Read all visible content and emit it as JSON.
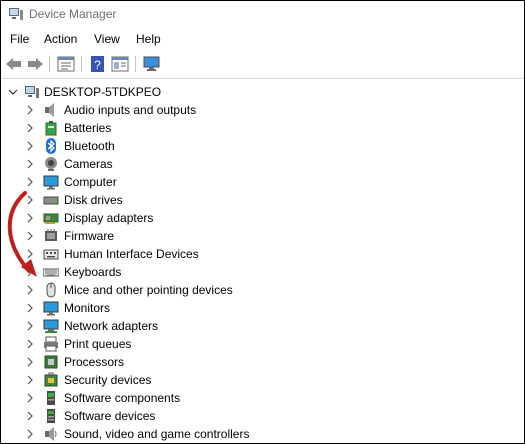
{
  "window": {
    "title": "Device Manager"
  },
  "menu": {
    "file": "File",
    "action": "Action",
    "view": "View",
    "help": "Help"
  },
  "tree": {
    "root": "DESKTOP-5TDKPEO",
    "items": [
      {
        "label": "Audio inputs and outputs",
        "icon": "speaker-icon"
      },
      {
        "label": "Batteries",
        "icon": "battery-icon"
      },
      {
        "label": "Bluetooth",
        "icon": "bluetooth-icon"
      },
      {
        "label": "Cameras",
        "icon": "camera-icon"
      },
      {
        "label": "Computer",
        "icon": "monitor-icon"
      },
      {
        "label": "Disk drives",
        "icon": "disk-drive-icon"
      },
      {
        "label": "Display adapters",
        "icon": "display-adapter-icon"
      },
      {
        "label": "Firmware",
        "icon": "firmware-icon"
      },
      {
        "label": "Human Interface Devices",
        "icon": "hid-icon"
      },
      {
        "label": "Keyboards",
        "icon": "keyboard-icon"
      },
      {
        "label": "Mice and other pointing devices",
        "icon": "mouse-icon"
      },
      {
        "label": "Monitors",
        "icon": "monitor-icon"
      },
      {
        "label": "Network adapters",
        "icon": "network-icon"
      },
      {
        "label": "Print queues",
        "icon": "printer-icon"
      },
      {
        "label": "Processors",
        "icon": "processor-icon"
      },
      {
        "label": "Security devices",
        "icon": "security-icon"
      },
      {
        "label": "Software components",
        "icon": "software-component-icon"
      },
      {
        "label": "Software devices",
        "icon": "software-device-icon"
      },
      {
        "label": "Sound, video and game controllers",
        "icon": "sound-icon"
      }
    ]
  },
  "colors": {
    "annotation_arrow": "#c0201c",
    "title_text": "#6d6d6d"
  }
}
